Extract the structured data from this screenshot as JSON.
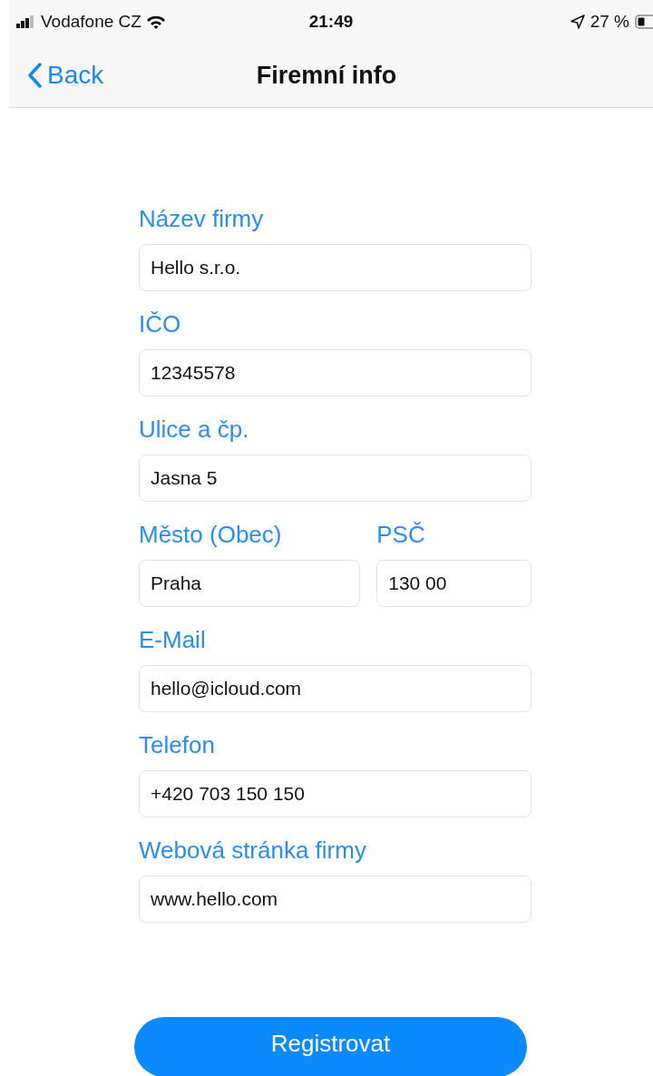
{
  "status_bar": {
    "carrier": "Vodafone CZ",
    "time": "21:49",
    "battery": "27 %"
  },
  "nav": {
    "back": "Back",
    "title": "Firemní info"
  },
  "form": [
    {
      "fields": [
        {
          "label": "Název firmy",
          "value": "Hello s.r.o."
        }
      ]
    },
    {
      "fields": [
        {
          "label": "IČO",
          "value": "12345578"
        }
      ]
    },
    {
      "fields": [
        {
          "label": "Ulice a čp.",
          "value": "Jasna 5"
        }
      ]
    },
    {
      "fields": [
        {
          "label": "Město (Obec)",
          "value": "Praha"
        },
        {
          "label": "PSČ",
          "value": "130 00"
        }
      ]
    },
    {
      "fields": [
        {
          "label": "E-Mail",
          "value": "hello@icloud.com"
        }
      ]
    },
    {
      "fields": [
        {
          "label": "Telefon",
          "value": "+420 703 150 150"
        }
      ]
    },
    {
      "fields": [
        {
          "label": "Webová stránka firmy",
          "value": "www.hello.com"
        }
      ]
    }
  ],
  "submit": "Registrovat"
}
